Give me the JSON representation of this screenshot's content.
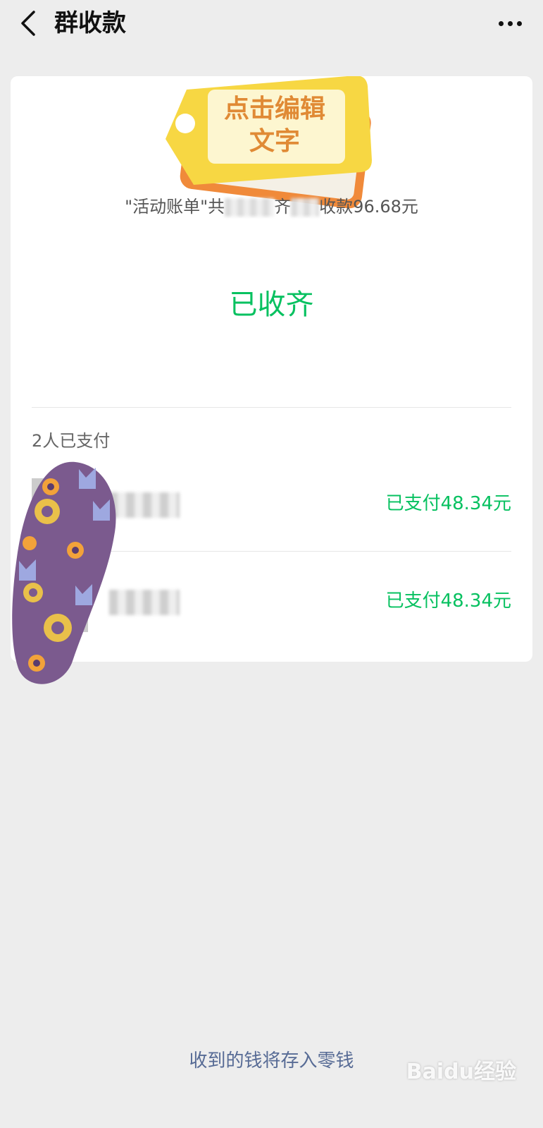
{
  "header": {
    "title": "群收款",
    "back_icon": "chevron-left-icon",
    "more_icon": "ellipsis-icon"
  },
  "card": {
    "edit_tag": {
      "line1": "点击编辑",
      "line2": "文字"
    },
    "summary": {
      "prefix": "\"活动账单\"共",
      "middle": "齐",
      "suffix": "收款96.68元"
    },
    "status": "已收齐",
    "paid_count": "2人已支付",
    "payments": [
      {
        "amount": "已支付48.34元"
      },
      {
        "amount": "已支付48.34元"
      }
    ]
  },
  "footer": {
    "note": "收到的钱将存入零钱"
  },
  "watermark": {
    "text": "Baidu经验"
  },
  "colors": {
    "accent_green": "#07c160",
    "link_blue": "#576b95",
    "background": "#ededed"
  }
}
